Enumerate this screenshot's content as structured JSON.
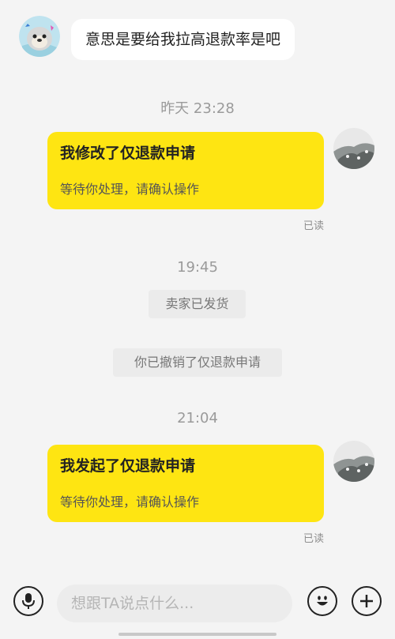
{
  "messages": {
    "incoming_text": "意思是要给我拉高退款率是吧",
    "time_1": "昨天 23:28",
    "card_1": {
      "title": "我修改了仅退款申请",
      "subtitle": "等待你处理，请确认操作",
      "status": "已读"
    },
    "time_2": "19:45",
    "system_1": "卖家已发货",
    "system_2": "你已撤销了仅退款申请",
    "time_3": "21:04",
    "card_2": {
      "title": "我发起了仅退款申请",
      "subtitle": "等待你处理，请确认操作",
      "status": "已读"
    }
  },
  "input_bar": {
    "placeholder": "想跟TA说点什么...",
    "voice_icon": "microphone-icon",
    "emoji_icon": "smiley-icon",
    "plus_icon": "plus-icon"
  },
  "colors": {
    "card_bg": "#fee512",
    "page_bg": "#f4f4f4",
    "bubble_bg": "#ffffff"
  }
}
